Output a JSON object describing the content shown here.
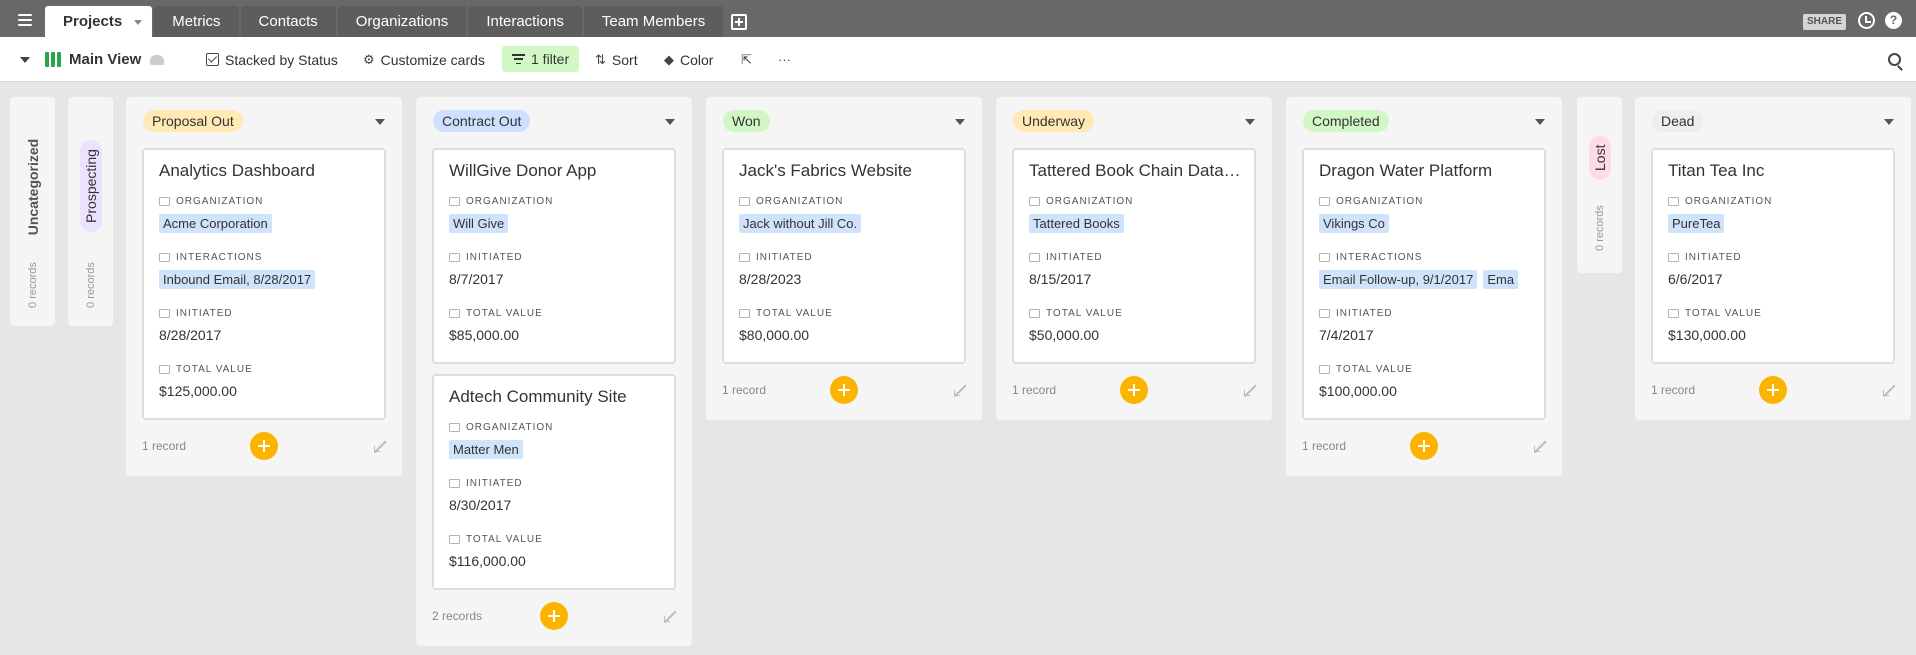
{
  "tabs": [
    "Projects",
    "Metrics",
    "Contacts",
    "Organizations",
    "Interactions",
    "Team Members"
  ],
  "topbar": {
    "share_label": "SHARE",
    "help_label": "?"
  },
  "toolbar": {
    "view_name": "Main View",
    "stacked_label": "Stacked by Status",
    "customize_label": "Customize cards",
    "filter_label": "1 filter",
    "sort_label": "Sort",
    "color_label": "Color"
  },
  "field_labels": {
    "organization": "ORGANIZATION",
    "interactions": "INTERACTIONS",
    "initiated": "INITIATED",
    "total_value": "TOTAL VALUE"
  },
  "collapsed_columns": [
    {
      "label": "Uncategorized",
      "count": "0 records",
      "pill_color": ""
    },
    {
      "label": "Prospecting",
      "count": "0 records",
      "pill_color": "#ede2fe"
    },
    {
      "label": "Lost",
      "count": "0 records",
      "pill_color": "#ffdce5"
    }
  ],
  "columns": [
    {
      "status": "Proposal Out",
      "pill_color": "#ffeab6",
      "count": "1 record",
      "cards": [
        {
          "title": "Analytics Dashboard",
          "organization": [
            "Acme Corporation"
          ],
          "interactions": [
            "Inbound Email, 8/28/2017"
          ],
          "initiated": "8/28/2017",
          "total_value": "$125,000.00"
        }
      ]
    },
    {
      "status": "Contract Out",
      "pill_color": "#cfdfff",
      "count": "2 records",
      "cards": [
        {
          "title": "WillGive Donor App",
          "organization": [
            "Will Give"
          ],
          "initiated": "8/7/2017",
          "total_value": "$85,000.00"
        },
        {
          "title": "Adtech Community Site",
          "organization": [
            "Matter Men"
          ],
          "initiated": "8/30/2017",
          "total_value": "$116,000.00"
        }
      ]
    },
    {
      "status": "Won",
      "pill_color": "#d1f7c4",
      "count": "1 record",
      "cards": [
        {
          "title": "Jack's Fabrics Website",
          "organization": [
            "Jack without Jill Co."
          ],
          "initiated": "8/28/2023",
          "total_value": "$80,000.00"
        }
      ]
    },
    {
      "status": "Underway",
      "pill_color": "#ffeab6",
      "count": "1 record",
      "cards": [
        {
          "title": "Tattered Book Chain Database",
          "organization": [
            "Tattered Books"
          ],
          "initiated": "8/15/2017",
          "total_value": "$50,000.00"
        }
      ]
    },
    {
      "status": "Completed",
      "pill_color": "#d1f7c4",
      "count": "1 record",
      "cards": [
        {
          "title": "Dragon Water Platform",
          "organization": [
            "Vikings Co"
          ],
          "interactions": [
            "Email Follow-up, 9/1/2017",
            "Ema"
          ],
          "initiated": "7/4/2017",
          "total_value": "$100,000.00"
        }
      ]
    },
    {
      "status": "Dead",
      "pill_color": "#eeeeee",
      "count": "1 record",
      "cards": [
        {
          "title": "Titan Tea Inc",
          "organization": [
            "PureTea"
          ],
          "initiated": "6/6/2017",
          "total_value": "$130,000.00"
        }
      ]
    }
  ]
}
